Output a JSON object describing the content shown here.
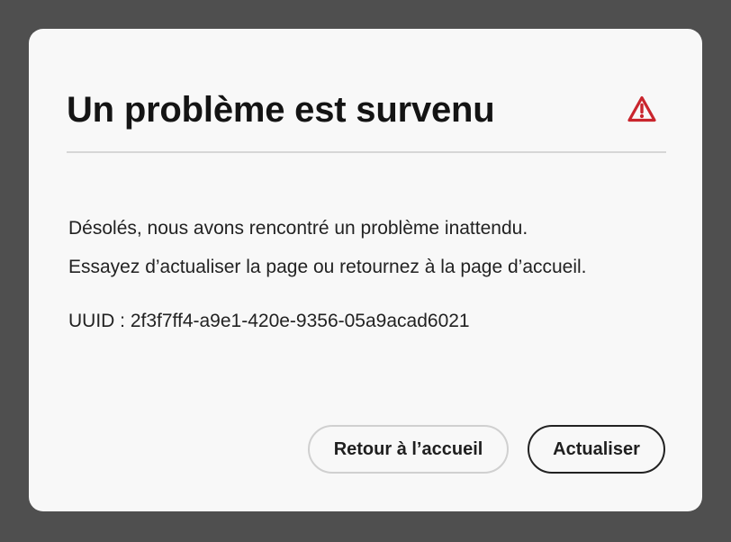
{
  "dialog": {
    "title": "Un problème est survenu",
    "icon": "warning-triangle-icon",
    "icon_color": "#c9252d",
    "message_line1": "Désolés, nous avons rencontré un problème inattendu.",
    "message_line2": "Essayez d’actualiser la page ou retournez à la page d’accueil.",
    "uuid": "UUID : 2f3f7ff4-a9e1-420e-9356-05a9acad6021",
    "buttons": {
      "home_label": "Retour à l’accueil",
      "refresh_label": "Actualiser"
    }
  }
}
